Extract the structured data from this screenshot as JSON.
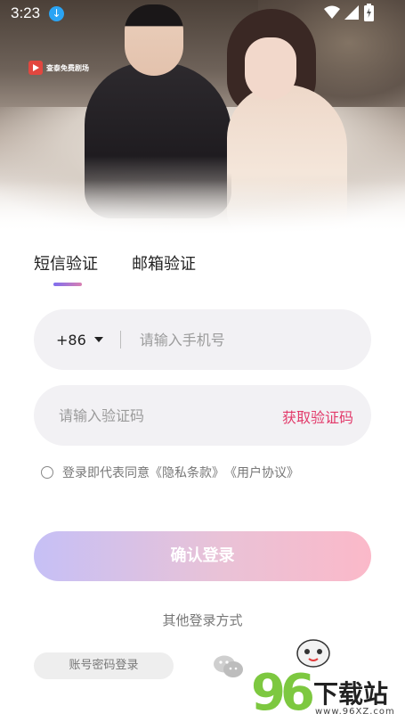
{
  "status_bar": {
    "time": "3:23"
  },
  "header": {
    "logo_text": "查泰免费剧场"
  },
  "tabs": [
    {
      "label": "短信验证",
      "active": true
    },
    {
      "label": "邮箱验证",
      "active": false
    }
  ],
  "phone": {
    "country_code": "+86",
    "placeholder": "请输入手机号"
  },
  "code": {
    "placeholder": "请输入验证码",
    "get_code_label": "获取验证码"
  },
  "agreement": {
    "prefix": "登录即代表同意",
    "privacy": "《隐私条款》",
    "terms": "《用户协议》"
  },
  "confirm_label": "确认登录",
  "other_methods_label": "其他登录方式",
  "password_login_label": "账号密码登录",
  "watermark": {
    "digits": "96",
    "text": "下载站",
    "url": "www.96XZ.com"
  },
  "colors": {
    "accent": "#e23a6a",
    "tab_indicator_start": "#7e6ef0",
    "tab_indicator_end": "#d97fb1"
  }
}
